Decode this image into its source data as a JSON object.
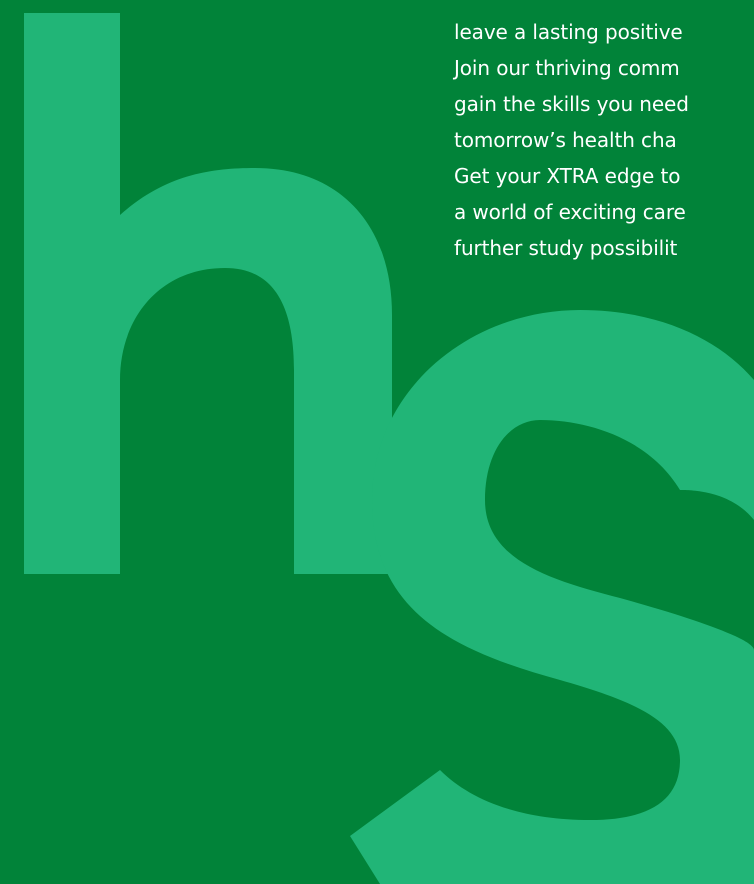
{
  "colors": {
    "background": "#018339",
    "letter_accent": "#21B577",
    "text": "#FFFFFF"
  },
  "decorative_letters": [
    "h",
    "s"
  ],
  "body_text": {
    "lines": [
      "leave a lasting positive",
      "Join our thriving comm",
      "gain the skills you need",
      "tomorrow’s health cha",
      "Get your XTRA edge to",
      "a world of exciting care",
      "further study possibilit"
    ]
  }
}
